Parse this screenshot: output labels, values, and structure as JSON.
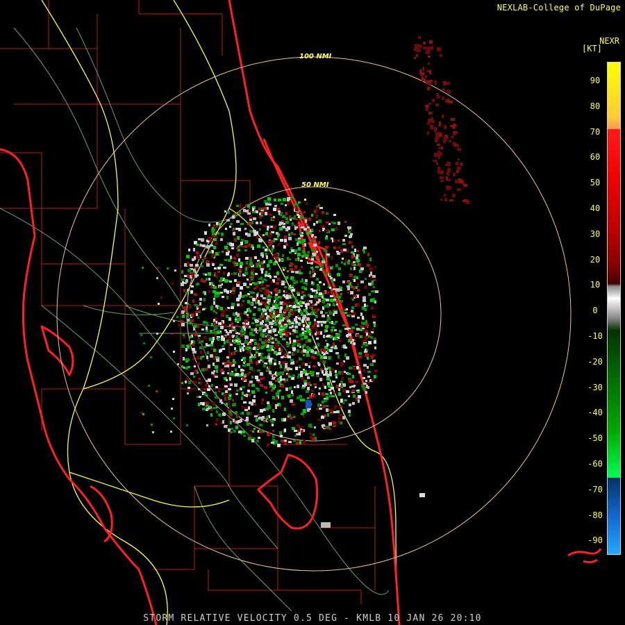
{
  "header": {
    "credit": "NEXLAB-College of DuPage"
  },
  "product": {
    "caption": "STORM RELATIVE VELOCITY 0.5 DEG - KMLB 10 JAN 26 20:10"
  },
  "range_rings": [
    {
      "label": "100 NMI"
    },
    {
      "label": "50 NMI"
    }
  ],
  "scale": {
    "title": "NEXR",
    "unit": "[KT]",
    "ticks": [
      "90",
      "80",
      "70",
      "60",
      "50",
      "40",
      "30",
      "20",
      "10",
      "0",
      "-10",
      "-20",
      "-30",
      "-40",
      "-50",
      "-60",
      "-70",
      "-80",
      "-90"
    ]
  },
  "colors": {
    "county_lines": "#cc2222",
    "coastline": "#ff2020",
    "highways": "#ffff33",
    "roads": "#88cc88",
    "rings": "#f0c0a0",
    "inbound": "#00aa00",
    "outbound": "#bb1111"
  }
}
